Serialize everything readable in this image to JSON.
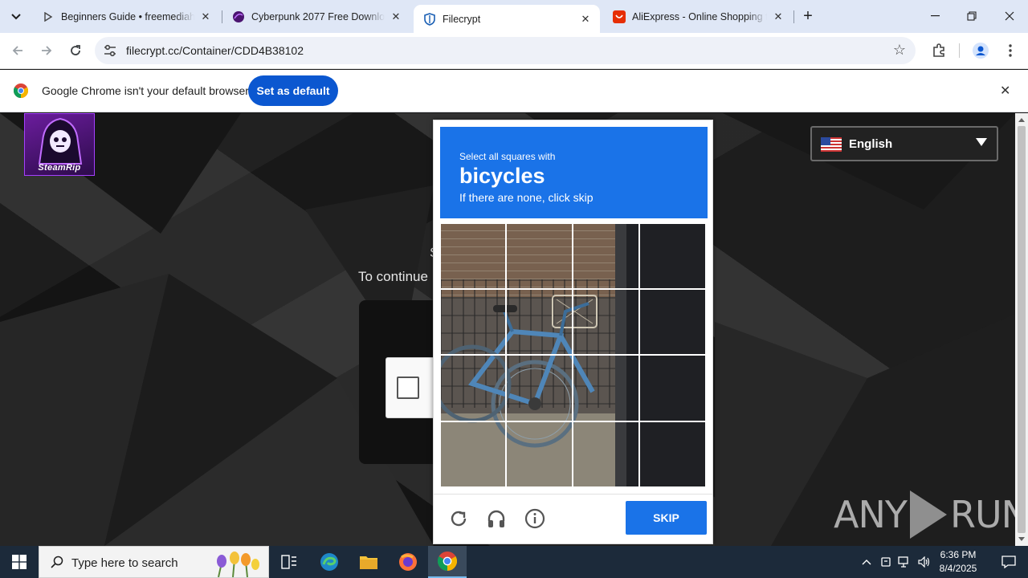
{
  "browser": {
    "tabs": [
      {
        "title": "Beginners Guide • freemediahe",
        "icon": "play-outline-icon"
      },
      {
        "title": "Cyberpunk 2077 Free Downloa",
        "icon": "purple-orb-icon"
      },
      {
        "title": "Filecrypt",
        "icon": "shield-icon"
      },
      {
        "title": "AliExpress - Online Shopping fo",
        "icon": "aliexpress-icon"
      }
    ],
    "url": "filecrypt.cc/Container/CDD4B38102"
  },
  "infobar": {
    "message": "Google Chrome isn't your default browser",
    "button_label": "Set as default"
  },
  "page": {
    "logo_text": "SteamRip",
    "heading_partial": "S",
    "instruction": "To continue",
    "language": "English"
  },
  "captcha": {
    "prompt_line1": "Select all squares with",
    "prompt_object": "bicycles",
    "prompt_line2": "If there are none, click skip",
    "skip_label": "SKIP",
    "accent_color": "#1a73e8"
  },
  "watermark": {
    "left": "ANY",
    "right": "RUN"
  },
  "taskbar": {
    "search_placeholder": "Type here to search",
    "time": "6:36 PM",
    "date": "8/4/2025"
  }
}
